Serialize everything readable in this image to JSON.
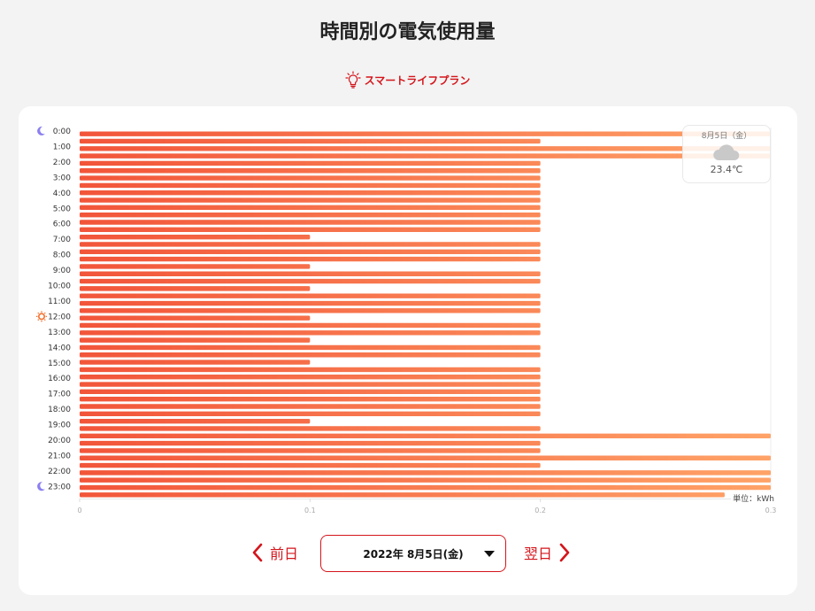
{
  "page": {
    "title": "時間別の電気使用量",
    "plan": "スマートライフプラン"
  },
  "weather": {
    "date": "8月5日（金）",
    "icon": "cloud-icon",
    "temp": "23.4℃"
  },
  "nav": {
    "prev_label": "前日",
    "next_label": "翌日",
    "selected_date": "2022年 8月5日(金)"
  },
  "unit_label": "単位：kWh",
  "colors": {
    "accent": "#d4151b",
    "bar_start": "#f2553a",
    "bar_end": "#ffa368",
    "moon": "#8b7ff0",
    "sun": "#f4712d"
  },
  "chart_data": {
    "type": "bar",
    "orientation": "horizontal",
    "xlim": [
      0,
      0.3
    ],
    "x_ticks": [
      "0",
      "0.1",
      "0.2",
      "0.3"
    ],
    "y_tick_labels": [
      "0:00",
      "1:00",
      "2:00",
      "3:00",
      "4:00",
      "5:00",
      "6:00",
      "7:00",
      "8:00",
      "9:00",
      "10:00",
      "11:00",
      "12:00",
      "13:00",
      "14:00",
      "15:00",
      "16:00",
      "17:00",
      "18:00",
      "19:00",
      "20:00",
      "21:00",
      "22:00",
      "23:00"
    ],
    "y_icons": [
      {
        "at": "0:00",
        "icon": "moon-icon"
      },
      {
        "at": "12:00",
        "icon": "sun-icon"
      },
      {
        "at": "23:00",
        "icon": "moon-icon"
      }
    ],
    "values": [
      0.3,
      0.2,
      0.3,
      0.3,
      0.2,
      0.2,
      0.2,
      0.2,
      0.2,
      0.2,
      0.2,
      0.2,
      0.2,
      0.2,
      0.1,
      0.2,
      0.2,
      0.2,
      0.1,
      0.2,
      0.2,
      0.1,
      0.2,
      0.2,
      0.2,
      0.1,
      0.2,
      0.2,
      0.1,
      0.2,
      0.2,
      0.1,
      0.2,
      0.2,
      0.2,
      0.2,
      0.2,
      0.2,
      0.2,
      0.1,
      0.2,
      0.3,
      0.2,
      0.2,
      0.3,
      0.2,
      0.3,
      0.3,
      0.3,
      0.28
    ],
    "grid": false,
    "legend": "none"
  }
}
